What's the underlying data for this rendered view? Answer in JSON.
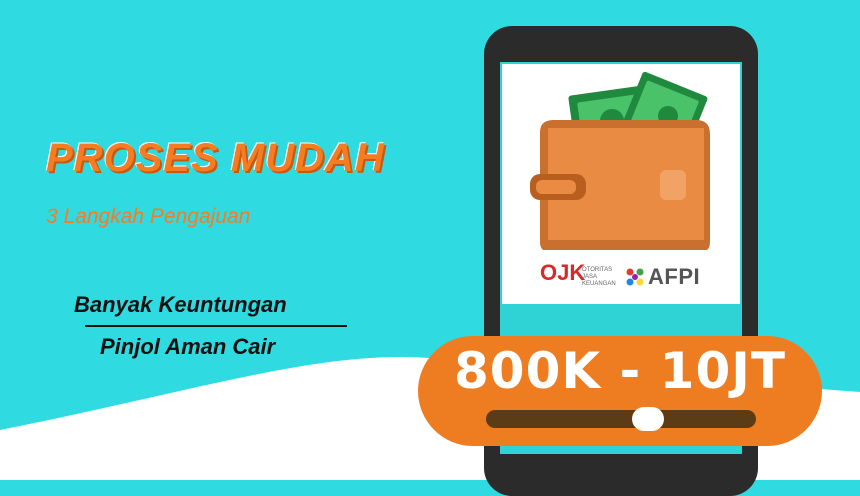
{
  "headline": "PROSES MUDAH",
  "subhead": "3 Langkah Pengajuan",
  "benefits": {
    "line1": "Banyak Keuntungan",
    "line2": "Pinjol Aman Cair"
  },
  "logos": {
    "ojk_mark": "OJK",
    "ojk_text": "OTORITAS JASA KEUANGAN",
    "afpi_text": "AFPI"
  },
  "loan": {
    "amount_range": "800K - 10JT",
    "slider_level": 0.6
  },
  "colors": {
    "background": "#2fdbe0",
    "accent_orange": "#ee7c21",
    "slider_track": "#5c3b17",
    "phone_body": "#2b2b2b"
  },
  "icons": [
    "wallet-icon",
    "money-icon",
    "ojk-logo-icon",
    "afpi-logo-icon"
  ]
}
